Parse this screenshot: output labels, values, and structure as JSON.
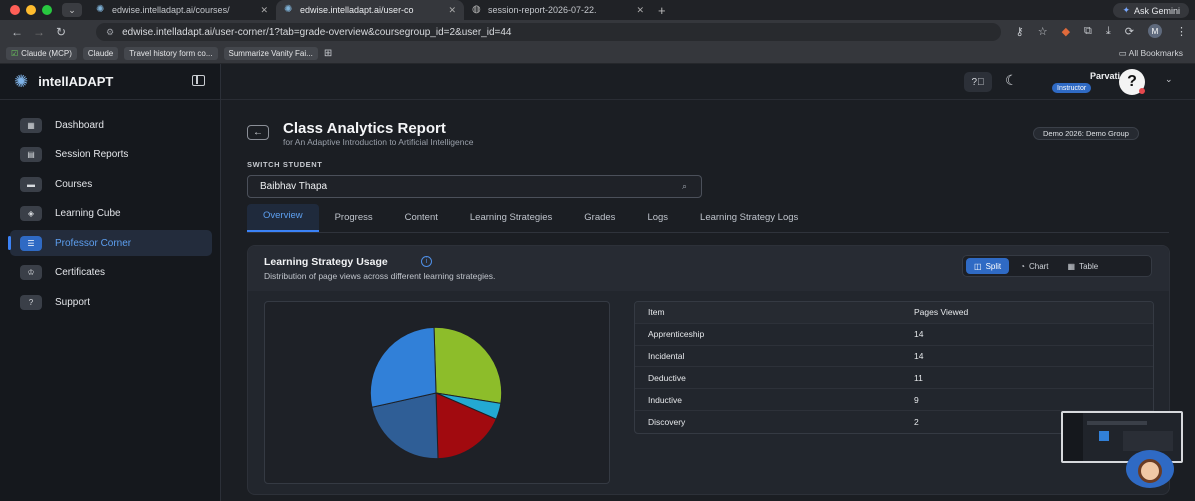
{
  "browser": {
    "tabs": [
      {
        "label": "edwise.intelladapt.ai/courses/",
        "active": false
      },
      {
        "label": "edwise.intelladapt.ai/user-co",
        "active": true
      },
      {
        "label": "session-report-2026-07-22.",
        "active": false
      }
    ],
    "gemini_label": "Ask Gemini",
    "url": "edwise.intelladapt.ai/user-corner/1?tab=grade-overview&coursegroup_id=2&user_id=44",
    "profile_initial": "M",
    "bookmarks": [
      "Claude (MCP)",
      "Claude",
      "Travel history form co...",
      "Summarize Vanity Fai..."
    ],
    "all_bookmarks": "All Bookmarks"
  },
  "app": {
    "brand": "intellADAPT",
    "sidebar": {
      "items": [
        {
          "label": "Dashboard",
          "icon": "dashboard-icon"
        },
        {
          "label": "Session Reports",
          "icon": "report-icon"
        },
        {
          "label": "Courses",
          "icon": "courses-icon"
        },
        {
          "label": "Learning Cube",
          "icon": "cube-icon"
        },
        {
          "label": "Professor Corner",
          "icon": "professor-icon",
          "active": true
        },
        {
          "label": "Certificates",
          "icon": "certificate-icon"
        },
        {
          "label": "Support",
          "icon": "support-icon"
        }
      ]
    },
    "user": {
      "name": "Parvati N",
      "role": "Instructor",
      "avatar": "?"
    }
  },
  "page": {
    "title": "Class Analytics Report",
    "subtitle": "for An Adaptive Introduction to Artificial Intelligence",
    "group_badge": "Demo 2026: Demo Group",
    "switch_label": "SWITCH STUDENT",
    "student": "Baibhav Thapa",
    "tabs": [
      "Overview",
      "Progress",
      "Content",
      "Learning Strategies",
      "Grades",
      "Logs",
      "Learning Strategy Logs"
    ],
    "active_tab": "Overview"
  },
  "card": {
    "title": "Learning Strategy Usage",
    "description": "Distribution of page views across different learning strategies.",
    "views": [
      "Split",
      "Chart",
      "Table"
    ],
    "active_view": "Split",
    "table": {
      "headers": [
        "Item",
        "Pages Viewed"
      ],
      "rows": [
        [
          "Apprenticeship",
          "14"
        ],
        [
          "Incidental",
          "14"
        ],
        [
          "Deductive",
          "11"
        ],
        [
          "Inductive",
          "9"
        ],
        [
          "Discovery",
          "2"
        ]
      ]
    }
  },
  "chart_data": {
    "type": "pie",
    "categories": [
      "Apprenticeship",
      "Incidental",
      "Deductive",
      "Inductive",
      "Discovery"
    ],
    "values": [
      14,
      14,
      11,
      9,
      2
    ],
    "colors": [
      "#8dbd2a",
      "#3180d8",
      "#2f5e96",
      "#a10a0f",
      "#23a9d2"
    ]
  }
}
